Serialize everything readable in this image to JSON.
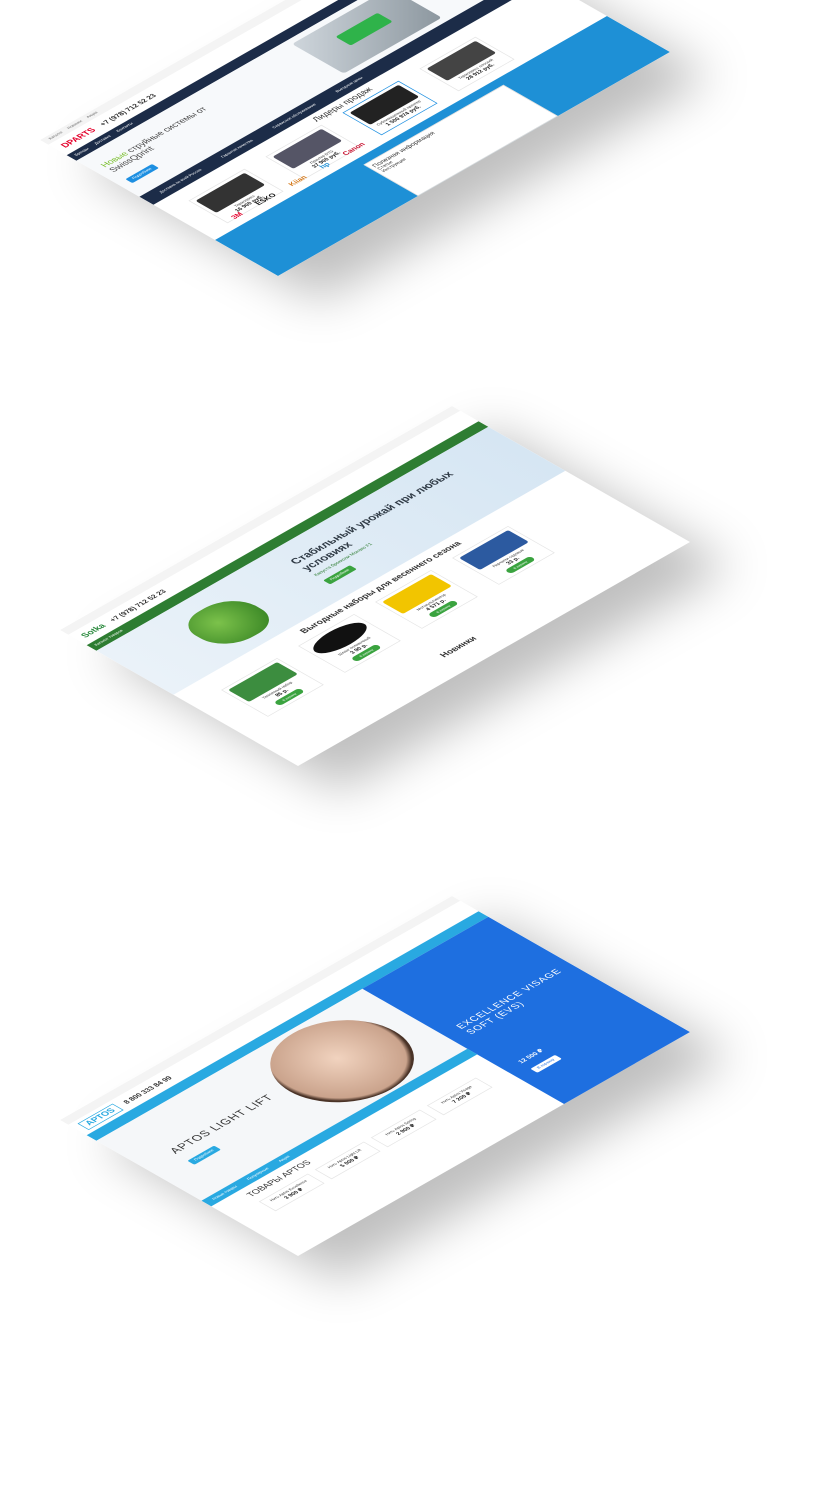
{
  "mock1": {
    "logo": "DPARTS",
    "phone": "+7 (978) 712 52 23",
    "nav": [
      "Каталог",
      "Новинки",
      "Акции",
      "Бренды",
      "Доставка",
      "Контакты"
    ],
    "hero_highlight": "Новые",
    "hero_title": "струйные системы от SwissQprint",
    "hero_button": "Подробнее",
    "strip": [
      "Доставка по всей России",
      "Гарантия качества",
      "Сервисное обслуживание",
      "Выгодные цены"
    ],
    "section_title": "Лидеры продаж",
    "products": [
      {
        "name": "Термопресс",
        "price": "16 900 руб."
      },
      {
        "name": "Принтер DTG",
        "price": "37 900 руб."
      },
      {
        "name": "Сублимационный принтер",
        "price": "1 500 974 руб."
      },
      {
        "name": "Термопресс плоский",
        "price": "28 912 руб."
      }
    ],
    "buy_label": "Купить",
    "brands": [
      "3M",
      "ESKO",
      "Kiian",
      "hp",
      "Canon"
    ],
    "info_title": "Полезная информация",
    "info_sub": "Статьи",
    "instructions": "Инструкции"
  },
  "mock2": {
    "logo": "Sotka",
    "phone": "+7 (978) 712 52 23",
    "catalog_label": "Каталог товаров",
    "hero_title": "Стабильный урожай при любых условиях",
    "hero_sub": "Капуста брокколи Монако F1",
    "hero_button": "Подробнее",
    "section_title": "Выгодные наборы для весеннего сезона",
    "products": [
      {
        "name": "Тепличный набор",
        "price": "85 р."
      },
      {
        "name": "Шланг поливочный",
        "price": "3 90 р."
      },
      {
        "name": "Мотокультиватор",
        "price": "4 571 р."
      },
      {
        "name": "Перчатки садовые",
        "price": "33 р."
      }
    ],
    "buy_label": "В корзину",
    "new_title": "Новинки"
  },
  "mock3": {
    "logo": "APTOS",
    "phone": "8 800 333 84 99",
    "hero_title": "APTOS LIGHT LIFT",
    "hero_button": "Подробнее",
    "side_title": "EXCELLENCE VISAGE SOFT (EVS)",
    "side_price": "12 500 ₽",
    "side_button": "В корзину",
    "tabs": [
      "Новые товары",
      "Популярные",
      "Акции"
    ],
    "section_title": "ТОВАРЫ APTOS",
    "products": [
      {
        "name": "Нить Aptos Excellence",
        "price": "3 900 ₽"
      },
      {
        "name": "Нить Aptos Light Lift",
        "price": "5 000 ₽"
      },
      {
        "name": "Нить Aptos Spring",
        "price": "2 900 ₽"
      },
      {
        "name": "Нить Aptos Visage",
        "price": "7 200 ₽"
      }
    ],
    "buy_label": "Купить"
  }
}
